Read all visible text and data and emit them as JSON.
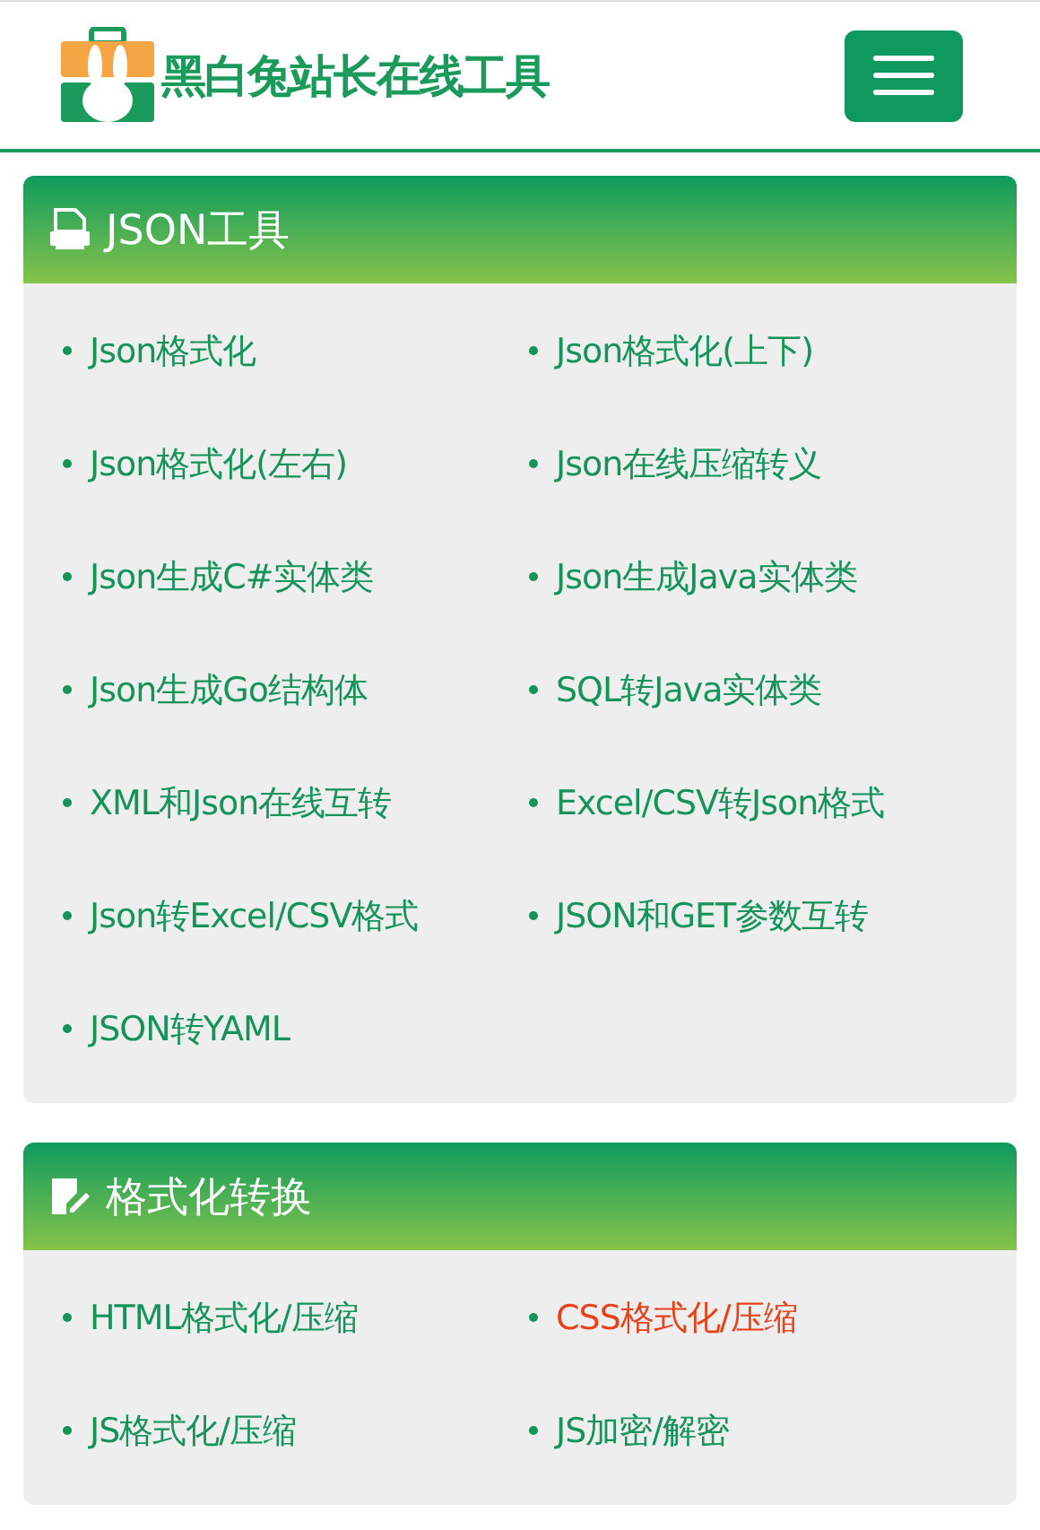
{
  "header": {
    "site_title": "黑白兔站长在线工具"
  },
  "sections": [
    {
      "title": "JSON工具",
      "kind": "json",
      "items": [
        {
          "label": "Json格式化",
          "highlighted": false
        },
        {
          "label": "Json格式化(上下)",
          "highlighted": false
        },
        {
          "label": "Json格式化(左右)",
          "highlighted": false
        },
        {
          "label": "Json在线压缩转义",
          "highlighted": false
        },
        {
          "label": "Json生成C#实体类",
          "highlighted": false
        },
        {
          "label": "Json生成Java实体类",
          "highlighted": false
        },
        {
          "label": "Json生成Go结构体",
          "highlighted": false
        },
        {
          "label": "SQL转Java实体类",
          "highlighted": false
        },
        {
          "label": "XML和Json在线互转",
          "highlighted": false
        },
        {
          "label": "Excel/CSV转Json格式",
          "highlighted": false
        },
        {
          "label": "Json转Excel/CSV格式",
          "highlighted": false
        },
        {
          "label": "JSON和GET参数互转",
          "highlighted": false
        },
        {
          "label": "JSON转YAML",
          "highlighted": false
        }
      ]
    },
    {
      "title": "格式化转换",
      "kind": "edit",
      "items": [
        {
          "label": "HTML格式化/压缩",
          "highlighted": false
        },
        {
          "label": "CSS格式化/压缩",
          "highlighted": true
        },
        {
          "label": "JS格式化/压缩",
          "highlighted": false
        },
        {
          "label": "JS加密/解密",
          "highlighted": false
        }
      ]
    }
  ]
}
